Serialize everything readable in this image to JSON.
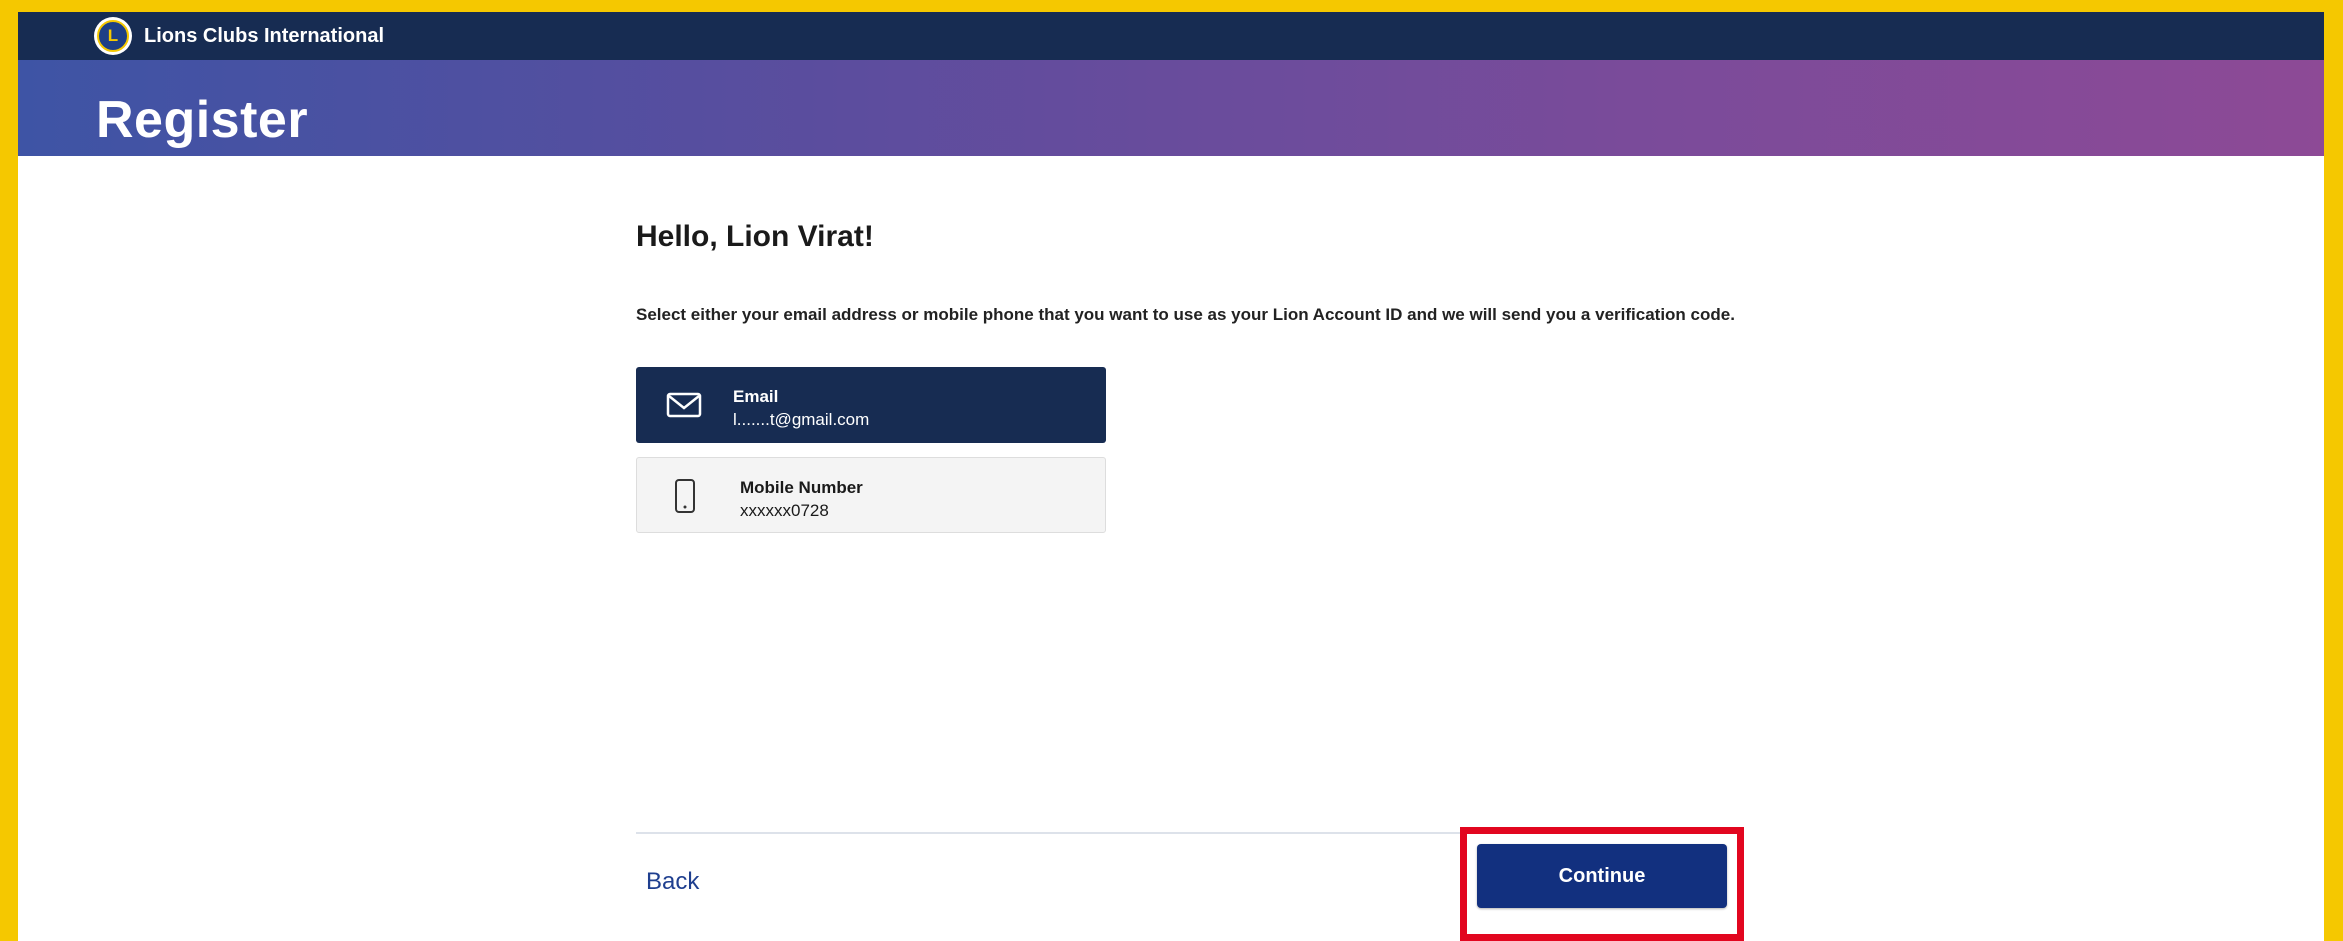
{
  "header": {
    "brand_name": "Lions Clubs International",
    "page_title": "Register"
  },
  "main": {
    "greeting": "Hello, Lion Virat!",
    "instructions": "Select either your email address or mobile phone that you want to use as your Lion Account ID and we will send you a verification code.",
    "options": [
      {
        "label": "Email",
        "value": "l.......t@gmail.com",
        "icon": "envelope-icon",
        "selected": true
      },
      {
        "label": "Mobile Number",
        "value": "xxxxxx0728",
        "icon": "mobile-phone-icon",
        "selected": false
      }
    ]
  },
  "footer": {
    "back_label": "Back",
    "continue_label": "Continue"
  },
  "colors": {
    "frame_border": "#f5c800",
    "topbar": "#172c52",
    "selected_option": "#172c52",
    "continue_button": "#12307f",
    "highlight_box": "#e2061f",
    "link": "#1f3f8f"
  }
}
